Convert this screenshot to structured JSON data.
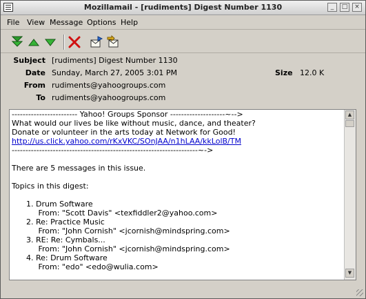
{
  "window": {
    "title": "Mozillamail - [rudiments] Digest Number 1130",
    "minimize_glyph": "_",
    "maximize_glyph": "□",
    "close_glyph": "×"
  },
  "menu": [
    "File",
    "View",
    "Message",
    "Options",
    "Help"
  ],
  "toolbar": {
    "buttons": [
      "next-message-icon",
      "previous-message-icon",
      "next-unread-icon",
      "delete-icon",
      "reply-icon",
      "forward-icon"
    ]
  },
  "header": {
    "subject_label": "Subject",
    "subject_value": "[rudiments] Digest Number 1130",
    "date_label": "Date",
    "date_value": "Sunday, March 27, 2005 3:01 PM",
    "size_label": "Size",
    "size_value": "12.0 K",
    "from_label": "From",
    "from_value": "rudiments@yahoogroups.com",
    "to_label": "To",
    "to_value": "rudiments@yahoogroups.com"
  },
  "body": {
    "lines": [
      "------------------------ Yahoo! Groups Sponsor --------------------~-->",
      "What would our lives be like without music, dance, and theater?",
      "Donate or volunteer in the arts today at Network for Good!",
      "http://us.click.yahoo.com/rKxVKC/SOnJAA/n1hLAA/kkLolB/TM",
      "--------------------------------------------------------------------~->",
      "",
      "There are 5 messages in this issue.",
      "",
      "Topics in this digest:",
      "",
      "      1. Drum Software",
      "           From: \"Scott Davis\" <texfiddler2@yahoo.com>",
      "      2. Re: Practice Music",
      "           From: \"John Cornish\" <jcornish@mindspring.com>",
      "      3. RE: Re: Cymbals...",
      "           From: \"John Cornish\" <jcornish@mindspring.com>",
      "      4. Re: Drum Software",
      "           From: \"edo\" <edo@wulia.com>"
    ],
    "link_line_index": 3
  }
}
